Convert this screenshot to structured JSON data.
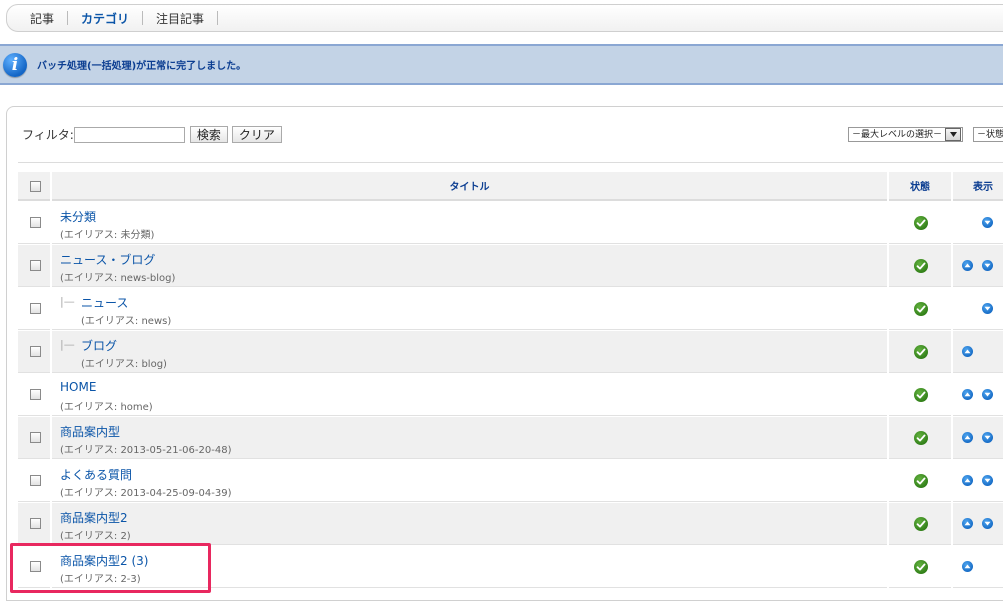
{
  "tabs": [
    {
      "label": "記事",
      "active": false
    },
    {
      "label": "カテゴリ",
      "active": true
    },
    {
      "label": "注目記事",
      "active": false
    }
  ],
  "message": {
    "icon": "info-icon",
    "text": "バッチ処理(一括処理)が正常に完了しました。"
  },
  "filter": {
    "label": "フィルタ:",
    "value": "",
    "search_button": "検索",
    "clear_button": "クリア"
  },
  "selects": {
    "max_level": "－最大レベルの選択－",
    "state": "－状態"
  },
  "table": {
    "headers": {
      "title": "タイトル",
      "state": "状態",
      "order": "表示"
    },
    "rows": [
      {
        "title": "未分類",
        "alias": "(エイリアス: 未分類)",
        "indent": false,
        "up": false,
        "down": true
      },
      {
        "title": "ニュース・ブログ",
        "alias": "(エイリアス: news-blog)",
        "indent": false,
        "up": true,
        "down": true
      },
      {
        "title": "ニュース",
        "alias": "(エイリアス: news)",
        "indent": true,
        "up": false,
        "down": true
      },
      {
        "title": "ブログ",
        "alias": "(エイリアス: blog)",
        "indent": true,
        "up": true,
        "down": false
      },
      {
        "title": "HOME",
        "alias": "(エイリアス: home)",
        "indent": false,
        "up": true,
        "down": true
      },
      {
        "title": "商品案内型",
        "alias": "(エイリアス: 2013-05-21-06-20-48)",
        "indent": false,
        "up": true,
        "down": true
      },
      {
        "title": "よくある質問",
        "alias": "(エイリアス: 2013-04-25-09-04-39)",
        "indent": false,
        "up": true,
        "down": true
      },
      {
        "title": "商品案内型2",
        "alias": "(エイリアス: 2)",
        "indent": false,
        "up": true,
        "down": true
      },
      {
        "title": "商品案内型2 (3)",
        "alias": "(エイリアス: 2-3)",
        "indent": false,
        "up": true,
        "down": false
      }
    ]
  },
  "colors": {
    "link": "#0b55a8",
    "highlight": "#e8285f",
    "published": "#3c8f1f",
    "message_bg": "#c3d3e6"
  }
}
